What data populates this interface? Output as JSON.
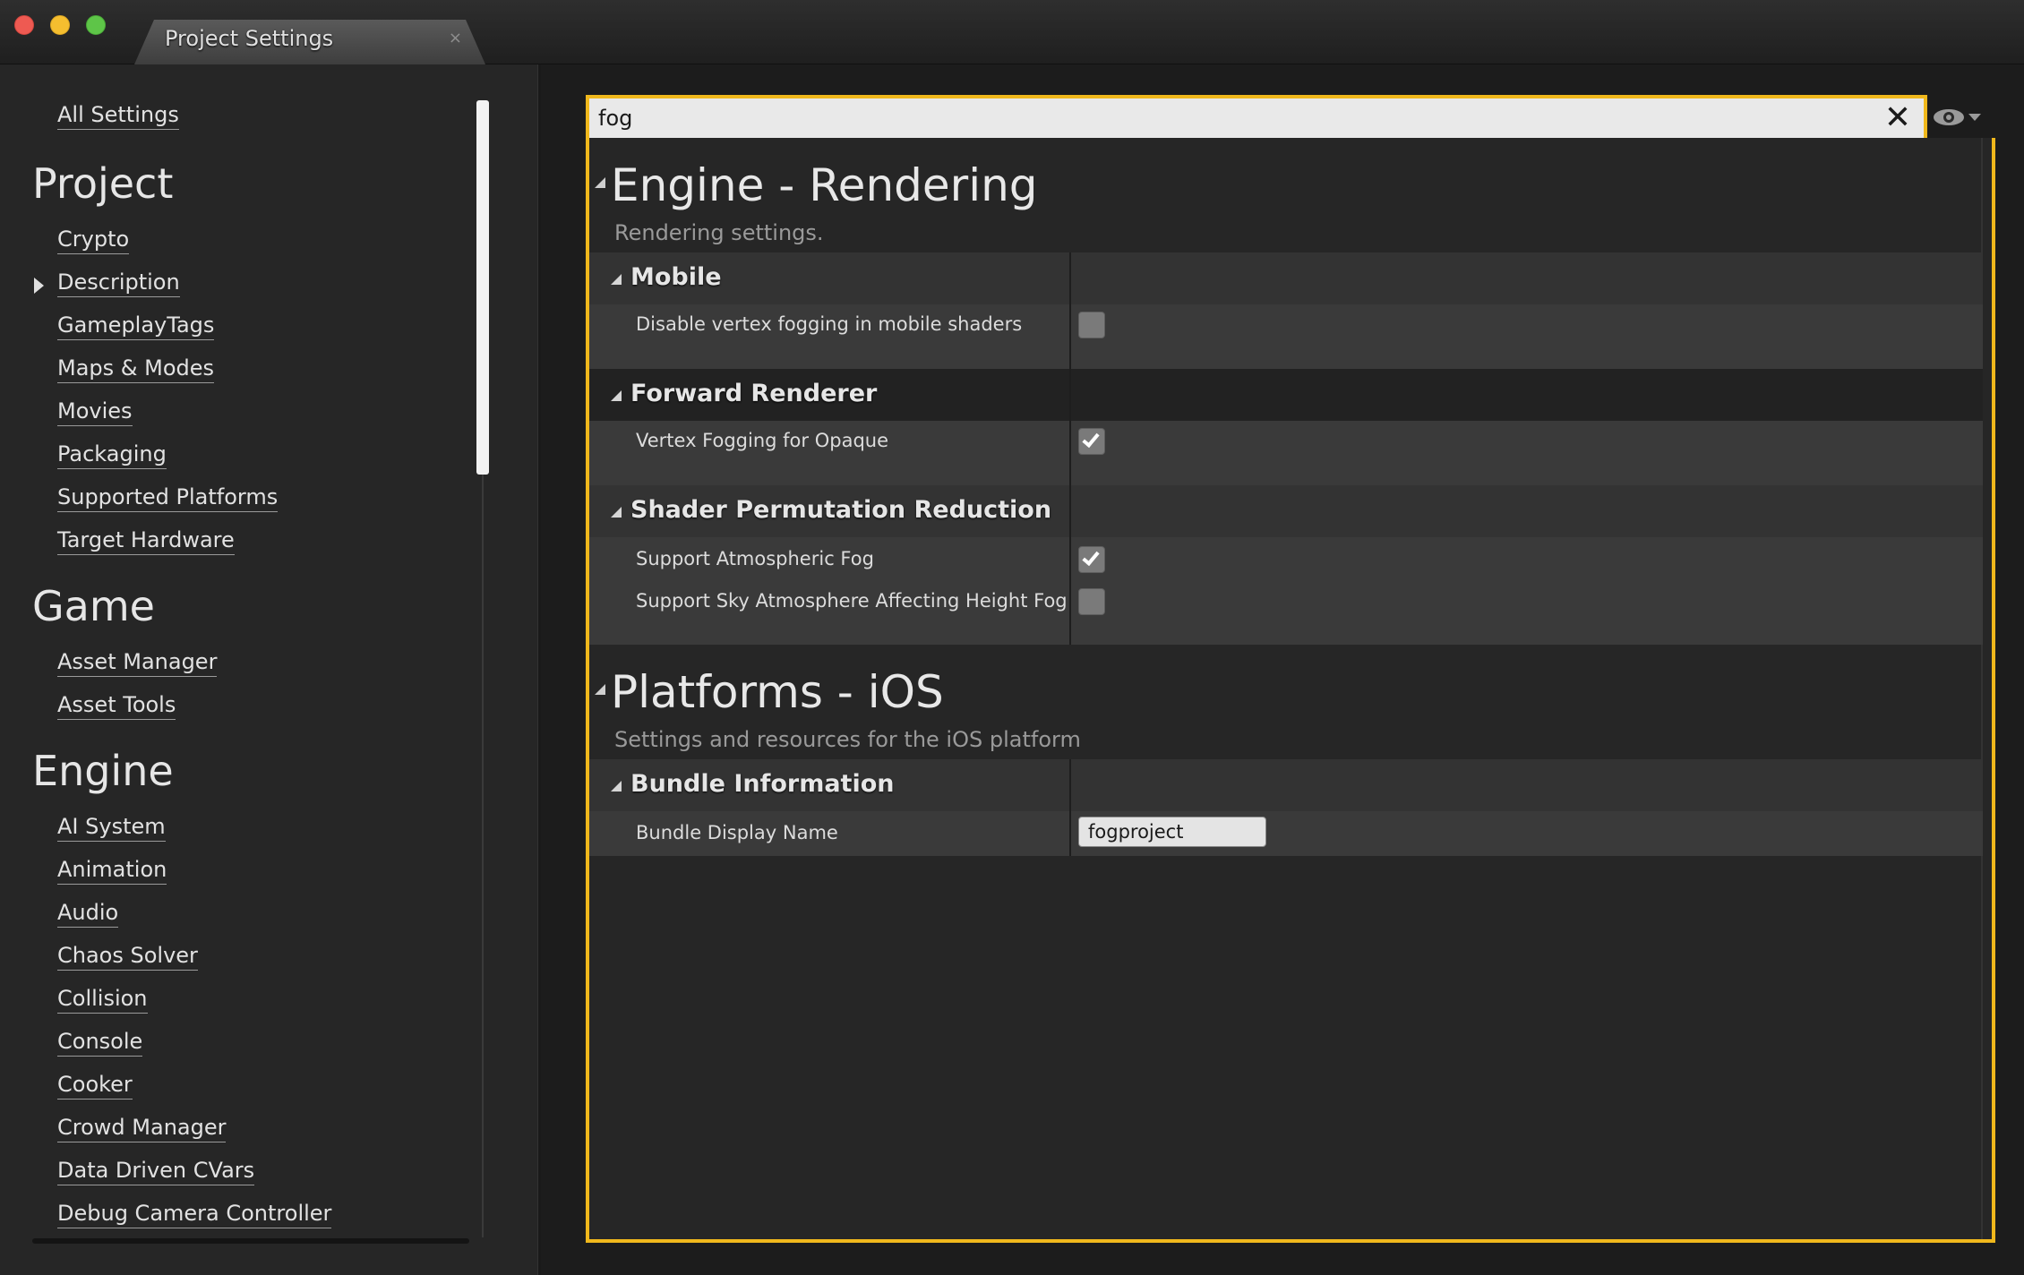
{
  "window": {
    "tab_title": "Project Settings",
    "tab_close": "×"
  },
  "sidebar": {
    "all_settings": "All Settings",
    "groups": [
      {
        "heading": "Project",
        "items": [
          "Crypto",
          "Description",
          "GameplayTags",
          "Maps & Modes",
          "Movies",
          "Packaging",
          "Supported Platforms",
          "Target Hardware"
        ]
      },
      {
        "heading": "Game",
        "items": [
          "Asset Manager",
          "Asset Tools"
        ]
      },
      {
        "heading": "Engine",
        "items": [
          "AI System",
          "Animation",
          "Audio",
          "Chaos Solver",
          "Collision",
          "Console",
          "Cooker",
          "Crowd Manager",
          "Data Driven CVars",
          "Debug Camera Controller"
        ]
      }
    ]
  },
  "search": {
    "value": "fog",
    "clear_icon": "close-x-icon",
    "visibility_icon": "eye-icon"
  },
  "results": {
    "categories": [
      {
        "title": "Engine - Rendering",
        "description": "Rendering settings.",
        "sections": [
          {
            "title": "Mobile",
            "properties": [
              {
                "label": "Disable vertex fogging in mobile shaders",
                "type": "checkbox",
                "checked": false
              }
            ]
          },
          {
            "title": "Forward Renderer",
            "properties": [
              {
                "label": "Vertex Fogging for Opaque",
                "type": "checkbox",
                "checked": true
              }
            ]
          },
          {
            "title": "Shader Permutation Reduction",
            "properties": [
              {
                "label": "Support Atmospheric Fog",
                "type": "checkbox",
                "checked": true
              },
              {
                "label": "Support Sky Atmosphere Affecting Height Fog",
                "type": "checkbox",
                "checked": false
              }
            ]
          }
        ]
      },
      {
        "title": "Platforms - iOS",
        "description": "Settings and resources for the iOS platform",
        "sections": [
          {
            "title": "Bundle Information",
            "properties": [
              {
                "label": "Bundle Display Name",
                "type": "text",
                "value": "fogproject"
              }
            ]
          }
        ]
      }
    ]
  },
  "colors": {
    "search_highlight": "#f0b81c",
    "panel_bg": "#262626",
    "row_bg": "#3a3a3a"
  }
}
